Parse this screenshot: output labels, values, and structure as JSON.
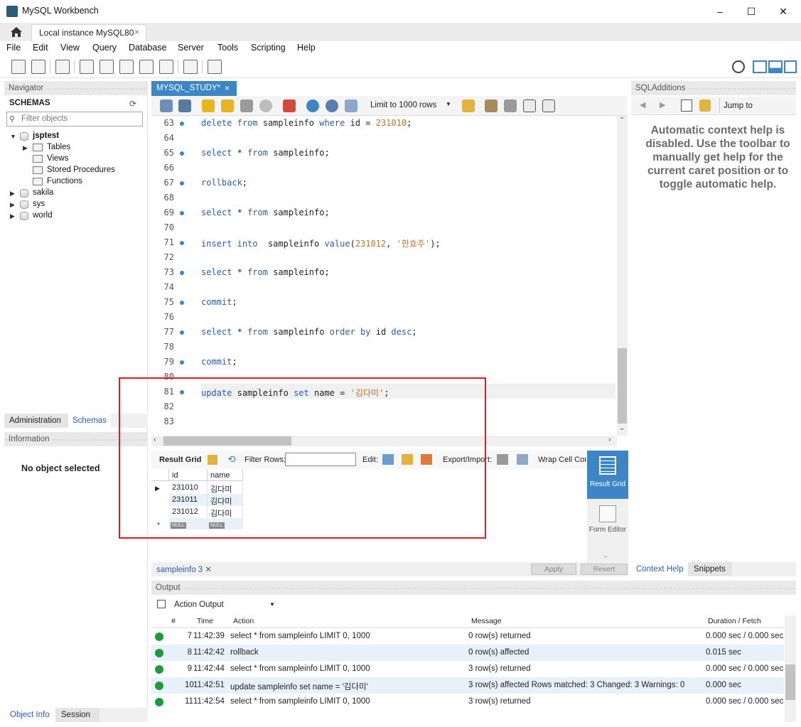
{
  "window": {
    "title": "MySQL Workbench",
    "minimize": "–",
    "maximize": "☐",
    "close": "✕"
  },
  "connection_tab": {
    "label": "Local instance MySQL80",
    "close": "×"
  },
  "menu": [
    "File",
    "Edit",
    "View",
    "Query",
    "Database",
    "Server",
    "Tools",
    "Scripting",
    "Help"
  ],
  "navigator": {
    "header": "Navigator",
    "schemas_label": "SCHEMAS",
    "filter_placeholder": "Filter objects",
    "tree": {
      "jsptest": "jsptest",
      "tables": "Tables",
      "views": "Views",
      "stored_procedures": "Stored Procedures",
      "functions": "Functions",
      "sakila": "sakila",
      "sys": "sys",
      "world": "world"
    },
    "tab_administration": "Administration",
    "tab_schemas": "Schemas",
    "info_header": "Information",
    "no_object": "No object selected",
    "tab_object_info": "Object Info",
    "tab_session": "Session"
  },
  "editor": {
    "tab_label": "MYSQL_STUDY*",
    "tab_close": "×",
    "limit_label": "Limit to 1000 rows",
    "lines": [
      {
        "no": "63",
        "dot": true,
        "code": "delete from sampleinfo where id = 231010;"
      },
      {
        "no": "64",
        "dot": false,
        "code": ""
      },
      {
        "no": "65",
        "dot": true,
        "code": "select * from sampleinfo;"
      },
      {
        "no": "66",
        "dot": false,
        "code": ""
      },
      {
        "no": "67",
        "dot": true,
        "code": "rollback;"
      },
      {
        "no": "68",
        "dot": false,
        "code": ""
      },
      {
        "no": "69",
        "dot": true,
        "code": "select * from sampleinfo;"
      },
      {
        "no": "70",
        "dot": false,
        "code": ""
      },
      {
        "no": "71",
        "dot": true,
        "code": "insert into  sampleinfo value(231012, '한효주');"
      },
      {
        "no": "72",
        "dot": false,
        "code": ""
      },
      {
        "no": "73",
        "dot": true,
        "code": "select * from sampleinfo;"
      },
      {
        "no": "74",
        "dot": false,
        "code": ""
      },
      {
        "no": "75",
        "dot": true,
        "code": "commit;"
      },
      {
        "no": "76",
        "dot": false,
        "code": ""
      },
      {
        "no": "77",
        "dot": true,
        "code": "select * from sampleinfo order by id desc;"
      },
      {
        "no": "78",
        "dot": false,
        "code": ""
      },
      {
        "no": "79",
        "dot": true,
        "code": "commit;"
      },
      {
        "no": "80",
        "dot": false,
        "code": ""
      },
      {
        "no": "81",
        "dot": true,
        "code": "update sampleinfo set name = '김다미';"
      },
      {
        "no": "82",
        "dot": false,
        "code": ""
      },
      {
        "no": "83",
        "dot": false,
        "code": ""
      }
    ]
  },
  "result": {
    "result_grid_label": "Result Grid",
    "filter_rows_label": "Filter Rows:",
    "edit_label": "Edit:",
    "export_label": "Export/Import:",
    "wrap_label": "Wrap Cell Cont",
    "columns": [
      "id",
      "name"
    ],
    "rows": [
      {
        "id": "231010",
        "name": "김다미"
      },
      {
        "id": "231011",
        "name": "김다미"
      },
      {
        "id": "231012",
        "name": "김다미"
      }
    ],
    "null_text": "NULL",
    "side_result_grid": "Result Grid",
    "side_form_editor": "Form Editor",
    "tab_label": "sampleinfo 3",
    "apply": "Apply",
    "revert": "Revert"
  },
  "sql_additions": {
    "header": "SQLAdditions",
    "jump_to": "Jump to",
    "help_text": "Automatic context help is disabled. Use the toolbar to manually get help for the current caret position or to toggle automatic help.",
    "tab_context_help": "Context Help",
    "tab_snippets": "Snippets"
  },
  "output": {
    "header": "Output",
    "mode": "Action Output",
    "columns": [
      "#",
      "Time",
      "Action",
      "Message",
      "Duration / Fetch"
    ],
    "rows": [
      {
        "n": "7",
        "time": "11:42:39",
        "action": "select * from sampleinfo LIMIT 0, 1000",
        "message": "0 row(s) returned",
        "duration": "0.000 sec / 0.000 sec"
      },
      {
        "n": "8",
        "time": "11:42:42",
        "action": "rollback",
        "message": "0 row(s) affected",
        "duration": "0.015 sec"
      },
      {
        "n": "9",
        "time": "11:42:44",
        "action": "select * from sampleinfo LIMIT 0, 1000",
        "message": "3 row(s) returned",
        "duration": "0.000 sec / 0.000 sec"
      },
      {
        "n": "10",
        "time": "11:42:51",
        "action": "update sampleinfo set name = '김다미'",
        "message": "3 row(s) affected Rows matched: 3  Changed: 3  Warnings: 0",
        "duration": "0.000 sec"
      },
      {
        "n": "11",
        "time": "11:42:54",
        "action": "select * from sampleinfo LIMIT 0, 1000",
        "message": "3 row(s) returned",
        "duration": "0.000 sec / 0.000 sec"
      }
    ]
  },
  "colors": {
    "accent": "#3d86c6",
    "highlight": "#e8191e",
    "ok": "#1f9a3a"
  }
}
